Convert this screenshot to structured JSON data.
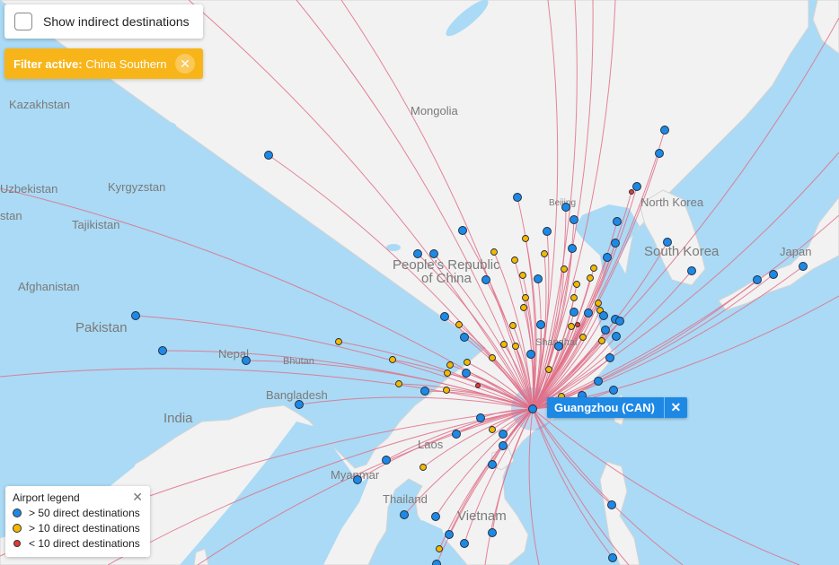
{
  "controls": {
    "indirect_label": "Show indirect destinations",
    "filter_prefix": "Filter active:",
    "filter_value": " China Southern",
    "filter_close_icon": "✕"
  },
  "selected_airport": {
    "label": "Guangzhou (CAN)",
    "close_icon": "✕"
  },
  "legend": {
    "title": "Airport legend",
    "close_icon": "✕",
    "items": [
      {
        "label": "> 50 direct destinations",
        "color": "#1e88e5"
      },
      {
        "label": "> 10 direct destinations",
        "color": "#f5b800"
      },
      {
        "label": "< 10 direct destinations",
        "color": "#e53935"
      }
    ]
  },
  "map_labels": {
    "kazakhstan": "Kazakhstan",
    "mongolia": "Mongolia",
    "uzbekistan": "Uzbekistan",
    "kyrgyzstan": "Kyrgyzstan",
    "tajikistan": "Tajikistan",
    "stan": "stan",
    "afghanistan": "Afghanistan",
    "pakistan": "Pakistan",
    "nepal": "Nepal",
    "bhutan": "Bhutan",
    "bangladesh": "Bangladesh",
    "india": "India",
    "china1": "People's Republic",
    "china2": "of China",
    "north_korea": "North Korea",
    "south_korea": "South Korea",
    "japan": "Japan",
    "beijing": "Beijing",
    "shanghai": "Shanghai",
    "laos": "Laos",
    "myanmar": "Myanmar",
    "thailand": "Thailand",
    "vietnam": "Vietnam"
  },
  "colors": {
    "route": "#e07088",
    "land": "#f2f2f2",
    "water": "#aadaf5",
    "hub": "#1e88e5",
    "large": "#1e88e5",
    "medium": "#f5b800",
    "small": "#e53935"
  }
}
